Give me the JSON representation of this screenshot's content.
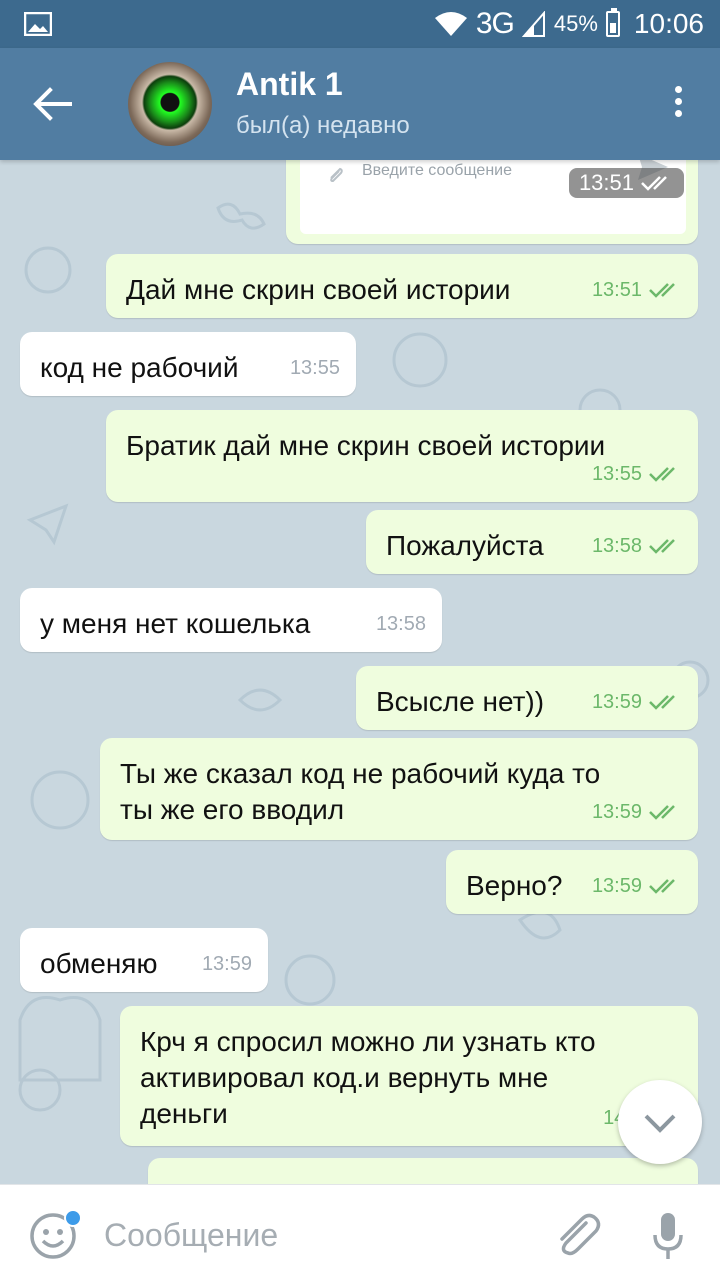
{
  "status_bar": {
    "network": "3G",
    "battery": "45%",
    "time": "10:06"
  },
  "header": {
    "title": "Antik 1",
    "status": "был(а) недавно"
  },
  "preview": {
    "placeholder": "Введите сообщение",
    "time": "13:51"
  },
  "messages": [
    {
      "dir": "out",
      "text": "Дай мне скрин своей истории",
      "time": "13:51"
    },
    {
      "dir": "in",
      "text": "код не рабочий",
      "time": "13:55"
    },
    {
      "dir": "out",
      "text": "Братик дай мне скрин своей истории",
      "time": "13:55"
    },
    {
      "dir": "out",
      "text": "Пожалуйста",
      "time": "13:58"
    },
    {
      "dir": "in",
      "text": "у меня нет кошелька",
      "time": "13:58"
    },
    {
      "dir": "out",
      "text": "Всысле нет))",
      "time": "13:59"
    },
    {
      "dir": "out",
      "text": "Ты же сказал код не рабочий куда то\nты же его вводил",
      "time": "13:59"
    },
    {
      "dir": "out",
      "text": "Верно?",
      "time": "13:59"
    },
    {
      "dir": "in",
      "text": "обменяю",
      "time": "13:59"
    },
    {
      "dir": "out",
      "text": "Крч я спросил можно ли узнать кто\nактивировал код.и вернуть мне\nденьги",
      "time": "14:0"
    }
  ],
  "input": {
    "placeholder": "Сообщение"
  },
  "colors": {
    "header": "#517da2",
    "status_bar": "#3d6a8e",
    "outgoing_bubble": "#effdde",
    "incoming_bubble": "#ffffff",
    "tick": "#6cb86a",
    "chat_bg": "#c9d7df"
  },
  "icons": {
    "back": "arrow-left",
    "menu": "more-vertical",
    "emoji": "smiley",
    "attach": "paperclip",
    "mic": "microphone",
    "scroll": "chevron-down"
  }
}
